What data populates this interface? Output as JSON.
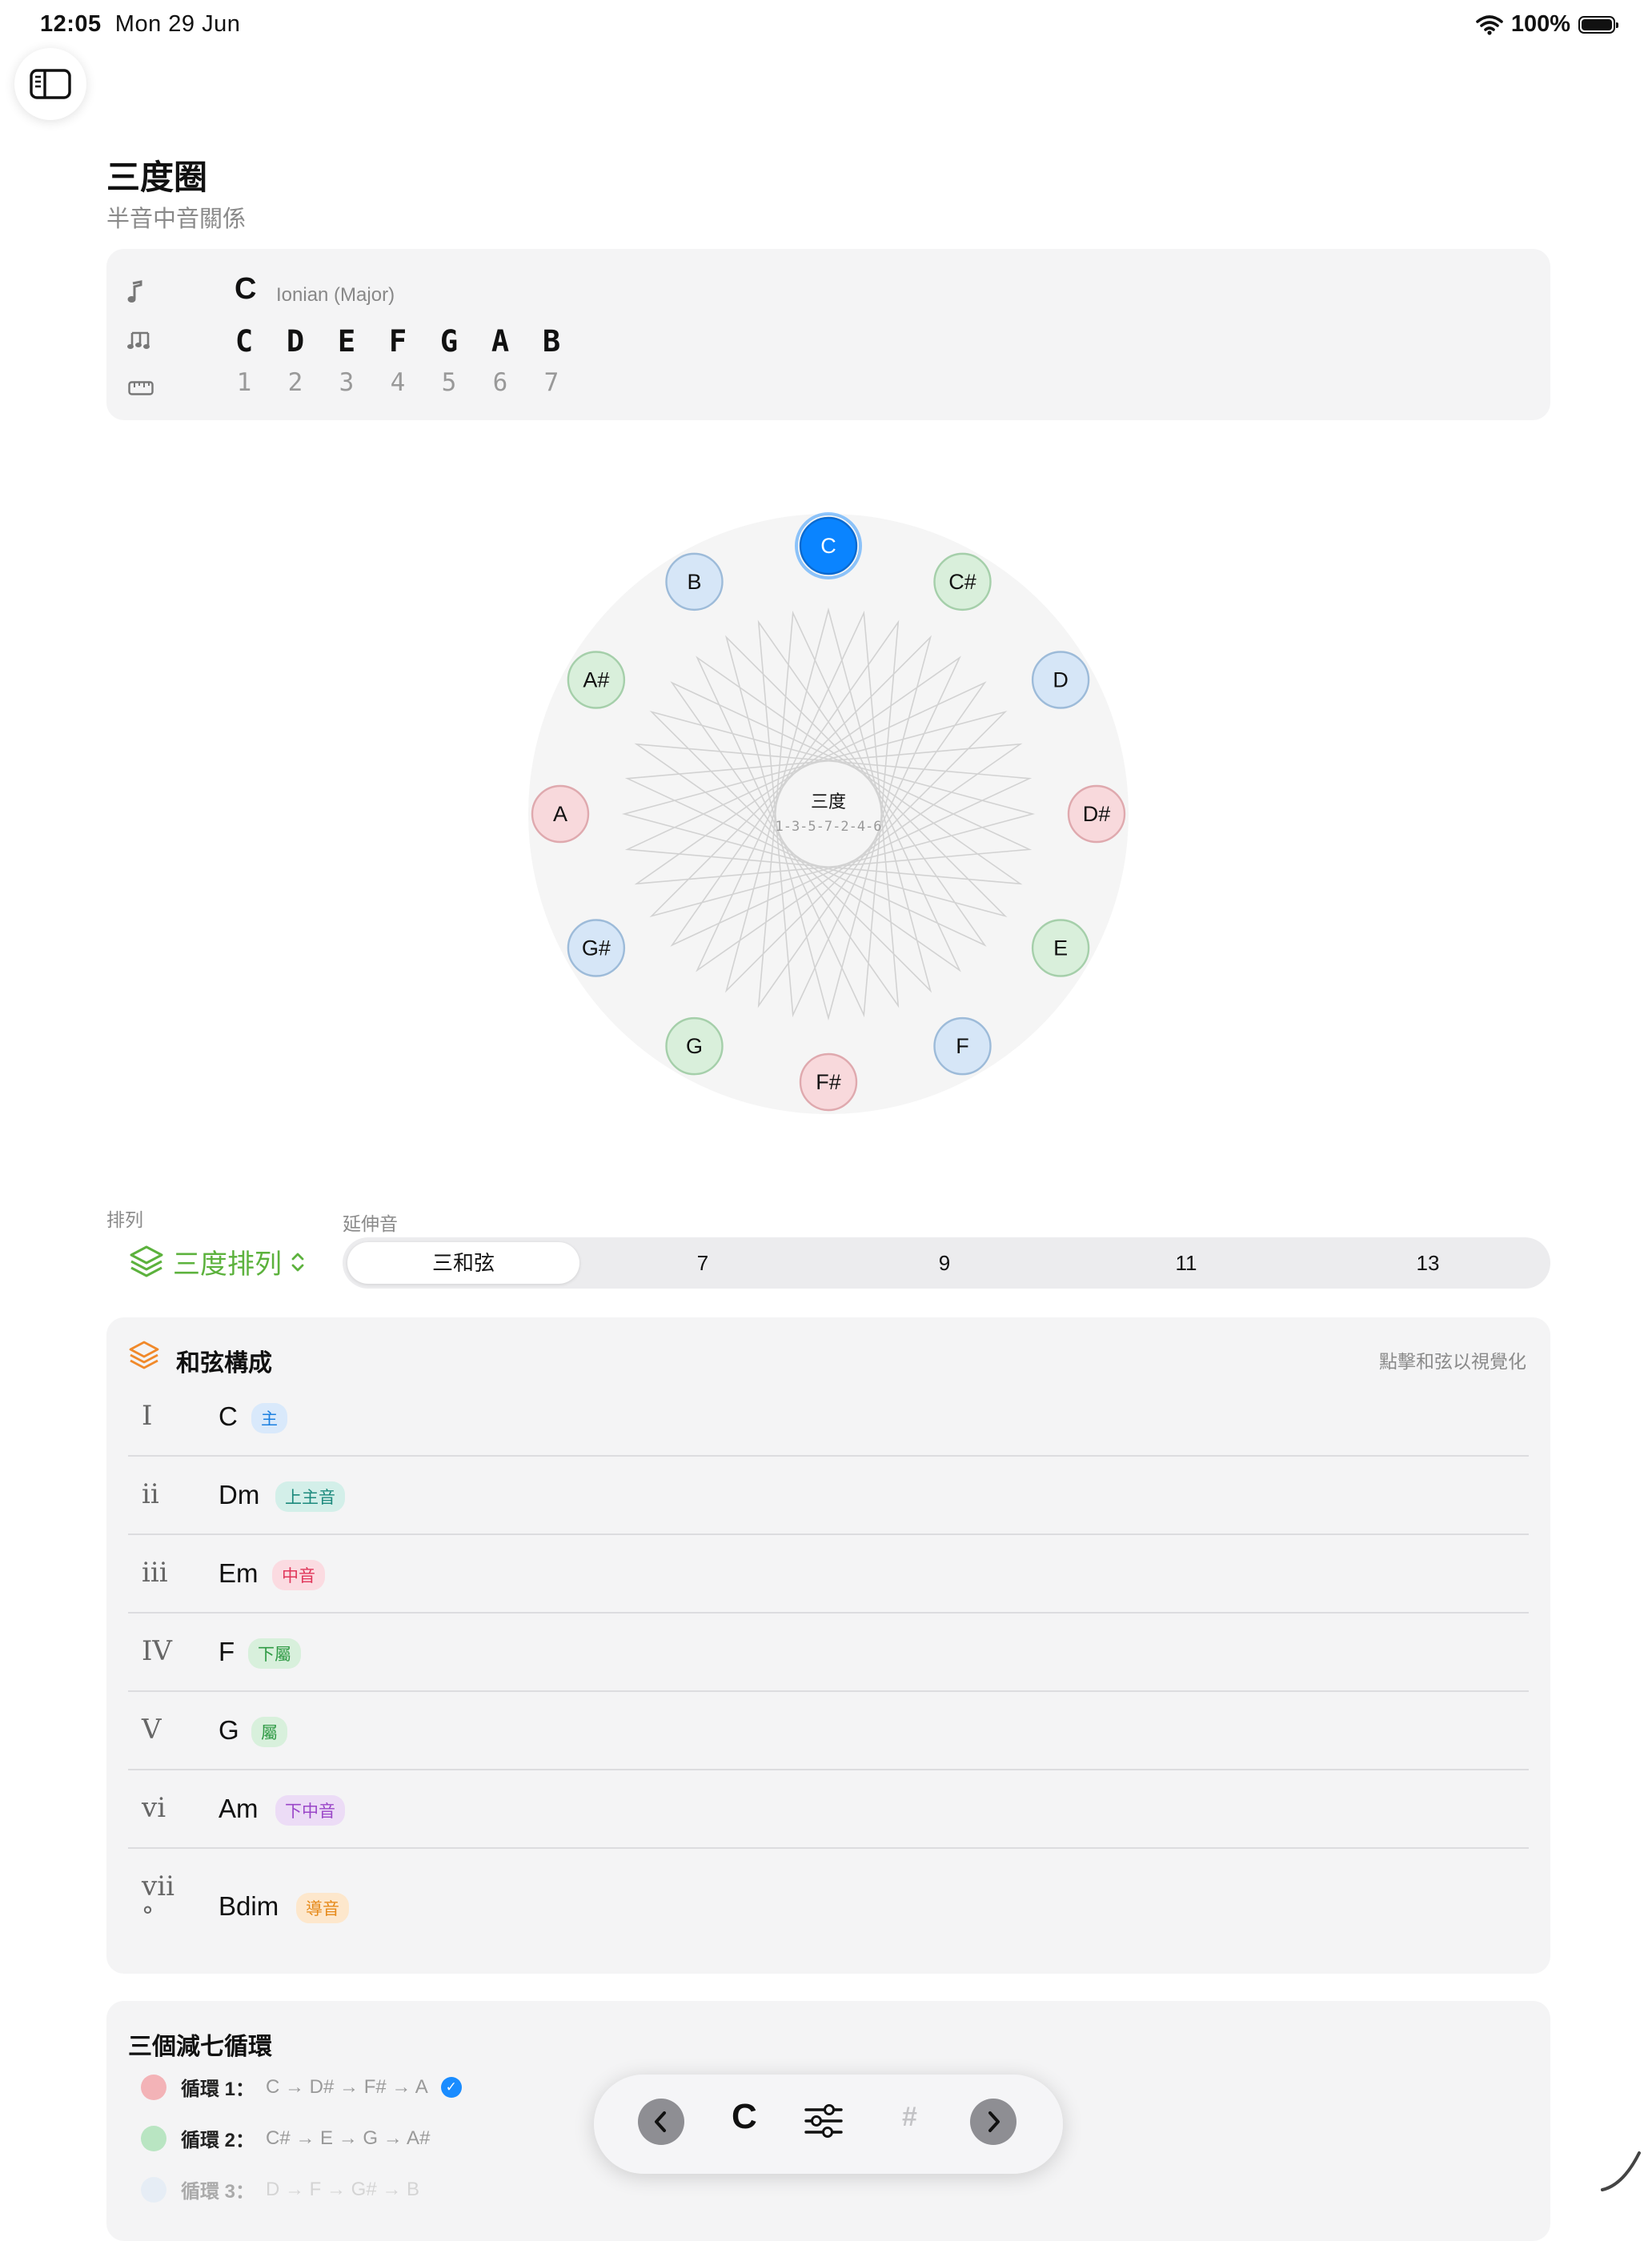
{
  "status_bar": {
    "time": "12:05",
    "date": "Mon 29 Jun",
    "battery": "100%"
  },
  "header": {
    "title": "三度圈",
    "subtitle": "半音中音關係"
  },
  "scale_info": {
    "root": "C",
    "mode": "Ionian (Major)",
    "notes": [
      "C",
      "D",
      "E",
      "F",
      "G",
      "A",
      "B"
    ],
    "degrees": [
      "1",
      "2",
      "3",
      "4",
      "5",
      "6",
      "7"
    ],
    "icons": [
      "music-note-icon",
      "music-notes-icon",
      "ruler-icon"
    ]
  },
  "wheel": {
    "center_title": "三度",
    "center_sequence": "1-3-5-7-2-4-6",
    "selected": "C",
    "notes": [
      {
        "name": "C",
        "color": "blue-selected"
      },
      {
        "name": "C#",
        "color": "green"
      },
      {
        "name": "D",
        "color": "blue"
      },
      {
        "name": "D#",
        "color": "red"
      },
      {
        "name": "E",
        "color": "green"
      },
      {
        "name": "F",
        "color": "blue"
      },
      {
        "name": "F#",
        "color": "red"
      },
      {
        "name": "G",
        "color": "green"
      },
      {
        "name": "G#",
        "color": "blue"
      },
      {
        "name": "A",
        "color": "red"
      },
      {
        "name": "A#",
        "color": "green"
      },
      {
        "name": "B",
        "color": "blue"
      }
    ]
  },
  "arrangement": {
    "label": "排列",
    "value": "三度排列"
  },
  "extension": {
    "label": "延伸音",
    "options": [
      "三和弦",
      "7",
      "9",
      "11",
      "13"
    ],
    "selected": "三和弦"
  },
  "chords": {
    "title": "和弦構成",
    "hint": "點擊和弦以視覺化",
    "rows": [
      {
        "roman": "I",
        "name": "C",
        "badge": "主",
        "badge_color": "#1a7fe0",
        "badge_bg": "#d9e9fb"
      },
      {
        "roman": "ii",
        "name": "Dm",
        "badge": "上主音",
        "badge_color": "#1c8a7d",
        "badge_bg": "#d3efe9"
      },
      {
        "roman": "iii",
        "name": "Em",
        "badge": "中音",
        "badge_color": "#e0365a",
        "badge_bg": "#fbdbe1"
      },
      {
        "roman": "IV",
        "name": "F",
        "badge": "下屬",
        "badge_color": "#2f9a45",
        "badge_bg": "#d8f0dc"
      },
      {
        "roman": "V",
        "name": "G",
        "badge": "屬",
        "badge_color": "#2f9a45",
        "badge_bg": "#d8f0dc"
      },
      {
        "roman": "vi",
        "name": "Am",
        "badge": "下中音",
        "badge_color": "#9a46c8",
        "badge_bg": "#ecdcf6"
      },
      {
        "roman": "vii",
        "roman_suffix": "°",
        "name": "Bdim",
        "badge": "導音",
        "badge_color": "#e68a1a",
        "badge_bg": "#fde7cc"
      }
    ]
  },
  "cycles": {
    "title": "三個減七循環",
    "rows": [
      {
        "label": "循環 1：",
        "notes": "C → D# → F# → A",
        "color": "#f3b3b7",
        "checked": true
      },
      {
        "label": "循環 2：",
        "notes": "C# → E → G → A#",
        "color": "#b9e5c2",
        "checked": false
      },
      {
        "label": "循環 3：",
        "notes": "D → F → G# → B",
        "color": "#cde2f7",
        "checked": false
      }
    ]
  },
  "toolbar": {
    "key": "C",
    "sharp": "#"
  }
}
